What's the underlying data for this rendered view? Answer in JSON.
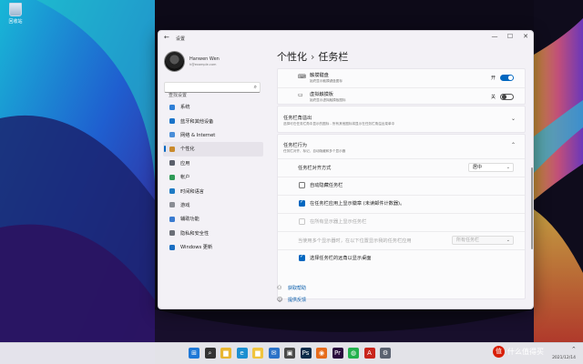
{
  "desktop": {
    "recycle_bin": "回收站"
  },
  "window": {
    "app_title": "设置",
    "back_glyph": "←",
    "controls": {
      "minimize": "—",
      "maximize": "☐",
      "close": "✕"
    }
  },
  "profile": {
    "name": "Hanwen Wen",
    "email": "h@example.com"
  },
  "search": {
    "placeholder": "查找设置",
    "icon": "search-icon"
  },
  "nav": {
    "items": [
      {
        "label": "系统",
        "icon": "monitor-icon",
        "color": "#2f7fd6"
      },
      {
        "label": "蓝牙和其他设备",
        "icon": "bluetooth-icon",
        "color": "#1a73c9"
      },
      {
        "label": "网络 & Internet",
        "icon": "wifi-icon",
        "color": "#4a8ed8"
      },
      {
        "label": "个性化",
        "icon": "brush-icon",
        "color": "#c98a2c"
      },
      {
        "label": "应用",
        "icon": "apps-icon",
        "color": "#5a5f6b"
      },
      {
        "label": "帐户",
        "icon": "person-icon",
        "color": "#2f9a57"
      },
      {
        "label": "时间和语言",
        "icon": "globe-icon",
        "color": "#1e7ac4"
      },
      {
        "label": "游戏",
        "icon": "gamepad-icon",
        "color": "#8a8d94"
      },
      {
        "label": "辅助功能",
        "icon": "accessibility-icon",
        "color": "#3a7bd0"
      },
      {
        "label": "隐私和安全性",
        "icon": "shield-icon",
        "color": "#6b6f77"
      },
      {
        "label": "Windows 更新",
        "icon": "update-icon",
        "color": "#1b6ec2"
      }
    ],
    "active_index": 3
  },
  "breadcrumb": {
    "parent": "个性化",
    "separator": "›",
    "current": "任务栏"
  },
  "touch_keyboard": {
    "title": "触摸键盘",
    "subtitle": "始终显示触摸键盘图标",
    "state": "开"
  },
  "virtual_touchpad": {
    "title": "虚拟触摸板",
    "subtitle": "始终显示虚拟触摸板图标",
    "state": "关"
  },
  "corner_overflow": {
    "title": "任务栏角溢出",
    "subtitle": "选择可在任务栏角中显示的图标 - 所有其他图标将显示在任务栏角溢出菜单中"
  },
  "behaviors": {
    "title": "任务栏行为",
    "subtitle": "任务栏对齐、标记、自动隐藏和多个显示器",
    "alignment": {
      "label": "任务栏对齐方式",
      "value": "居中"
    },
    "checks": [
      {
        "label": "自动隐藏任务栏",
        "state": "off"
      },
      {
        "label": "在任务栏应用上显示徽章 (未读邮件计数器)。",
        "state": "on"
      },
      {
        "label": "在所有显示器上显示任务栏",
        "state": "disabled"
      }
    ],
    "multi_display": {
      "label": "当使用多个显示器时，在以下位置显示我的任务栏应用",
      "value": "所有任务栏"
    },
    "far_corner": {
      "label": "选择任务栏的远角以显示桌面",
      "state": "on"
    }
  },
  "help": {
    "get_help": "获取帮助",
    "feedback": "提供反馈"
  },
  "taskbar": {
    "icons": [
      {
        "name": "windows-start-icon",
        "glyph": "⊞",
        "color": "#1e78d7"
      },
      {
        "name": "search-icon",
        "glyph": "⌕",
        "color": "#333333"
      },
      {
        "name": "file-explorer-icon",
        "glyph": "▆",
        "color": "#e8b631"
      },
      {
        "name": "edge-icon",
        "glyph": "e",
        "color": "#1b8fd1"
      },
      {
        "name": "folder-icon",
        "glyph": "▆",
        "color": "#f0c43e"
      },
      {
        "name": "mail-icon",
        "glyph": "✉",
        "color": "#2a72c8"
      },
      {
        "name": "store-icon",
        "glyph": "▣",
        "color": "#4a4a4a"
      },
      {
        "name": "photoshop-icon",
        "glyph": "Ps",
        "color": "#0a2c4a"
      },
      {
        "name": "firefox-icon",
        "glyph": "◉",
        "color": "#e66b1b"
      },
      {
        "name": "premiere-icon",
        "glyph": "Pr",
        "color": "#2a0a3d"
      },
      {
        "name": "wechat-icon",
        "glyph": "◍",
        "color": "#23b14d"
      },
      {
        "name": "acrobat-icon",
        "glyph": "A",
        "color": "#c8251c"
      },
      {
        "name": "settings-icon",
        "glyph": "⚙",
        "color": "#5a6270"
      }
    ],
    "tray_glyph": "^"
  },
  "watermark": {
    "badge": "值",
    "text": "什么值得买"
  },
  "clock": {
    "date": "2021/12/14"
  },
  "colors": {
    "accent": "#0067c0",
    "link": "#0058a8"
  }
}
